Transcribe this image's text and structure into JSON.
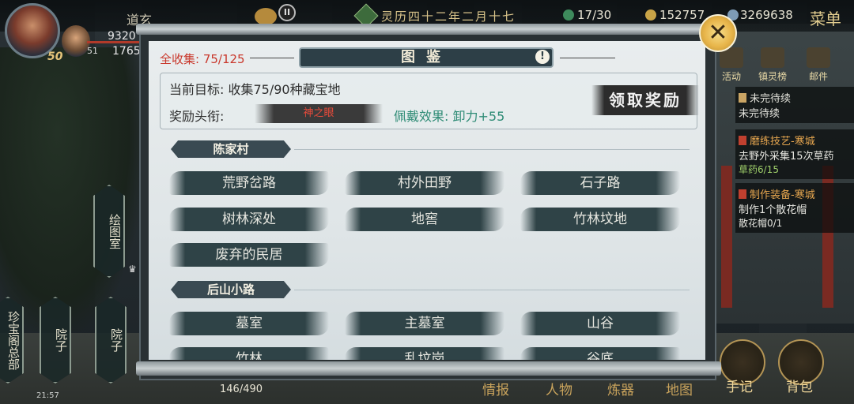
{
  "player": {
    "name": "道玄",
    "level": "50",
    "companion_level": "51",
    "stat_a": "9320",
    "stat_b": "1765"
  },
  "topbar": {
    "pause_icon": "pause-icon",
    "date": "灵历四十二年二月十七",
    "energy": "17/30",
    "coins": "152757",
    "silver": "3269638",
    "menu_label": "菜单"
  },
  "right_icons": [
    {
      "label": "活动"
    },
    {
      "label": "镇灵榜"
    },
    {
      "label": "邮件"
    }
  ],
  "quests": [
    {
      "title": "未完待续",
      "desc": "未完待续",
      "progress": ""
    },
    {
      "title": "磨练技艺-寒城",
      "desc": "去野外采集15次草药",
      "progress": "草药6/15"
    },
    {
      "title": "制作装备-寒城",
      "desc": "制作1个散花帽",
      "progress": "散花帽0/1"
    }
  ],
  "left_nav": {
    "drawing_room": "绘图室",
    "treasure_hq": "珍宝阁总部",
    "courtyard_1": "院子",
    "courtyard_2": "院子"
  },
  "status": {
    "time": "21:57",
    "xp": "146/490"
  },
  "bottom_menu": [
    "情报",
    "人物",
    "炼器",
    "地图",
    "手记",
    "背包"
  ],
  "panel": {
    "collect_label": "全收集: 75/125",
    "title": "图鉴",
    "info_icon": "!",
    "goal": "当前目标: 收集75/90种藏宝地",
    "reward_label": "奖励头衔:",
    "reward_title": "神之眼",
    "effect": "佩戴效果: 卸力+55",
    "claim_button": "领取奖励",
    "close_icon": "✕"
  },
  "sections": [
    {
      "name": "陈家村",
      "locations": [
        "荒野岔路",
        "村外田野",
        "石子路",
        "树林深处",
        "地窖",
        "竹林坟地",
        "废弃的民居"
      ]
    },
    {
      "name": "后山小路",
      "locations": [
        "墓室",
        "主墓室",
        "山谷",
        "竹林",
        "乱坟岗",
        "谷底"
      ]
    }
  ]
}
